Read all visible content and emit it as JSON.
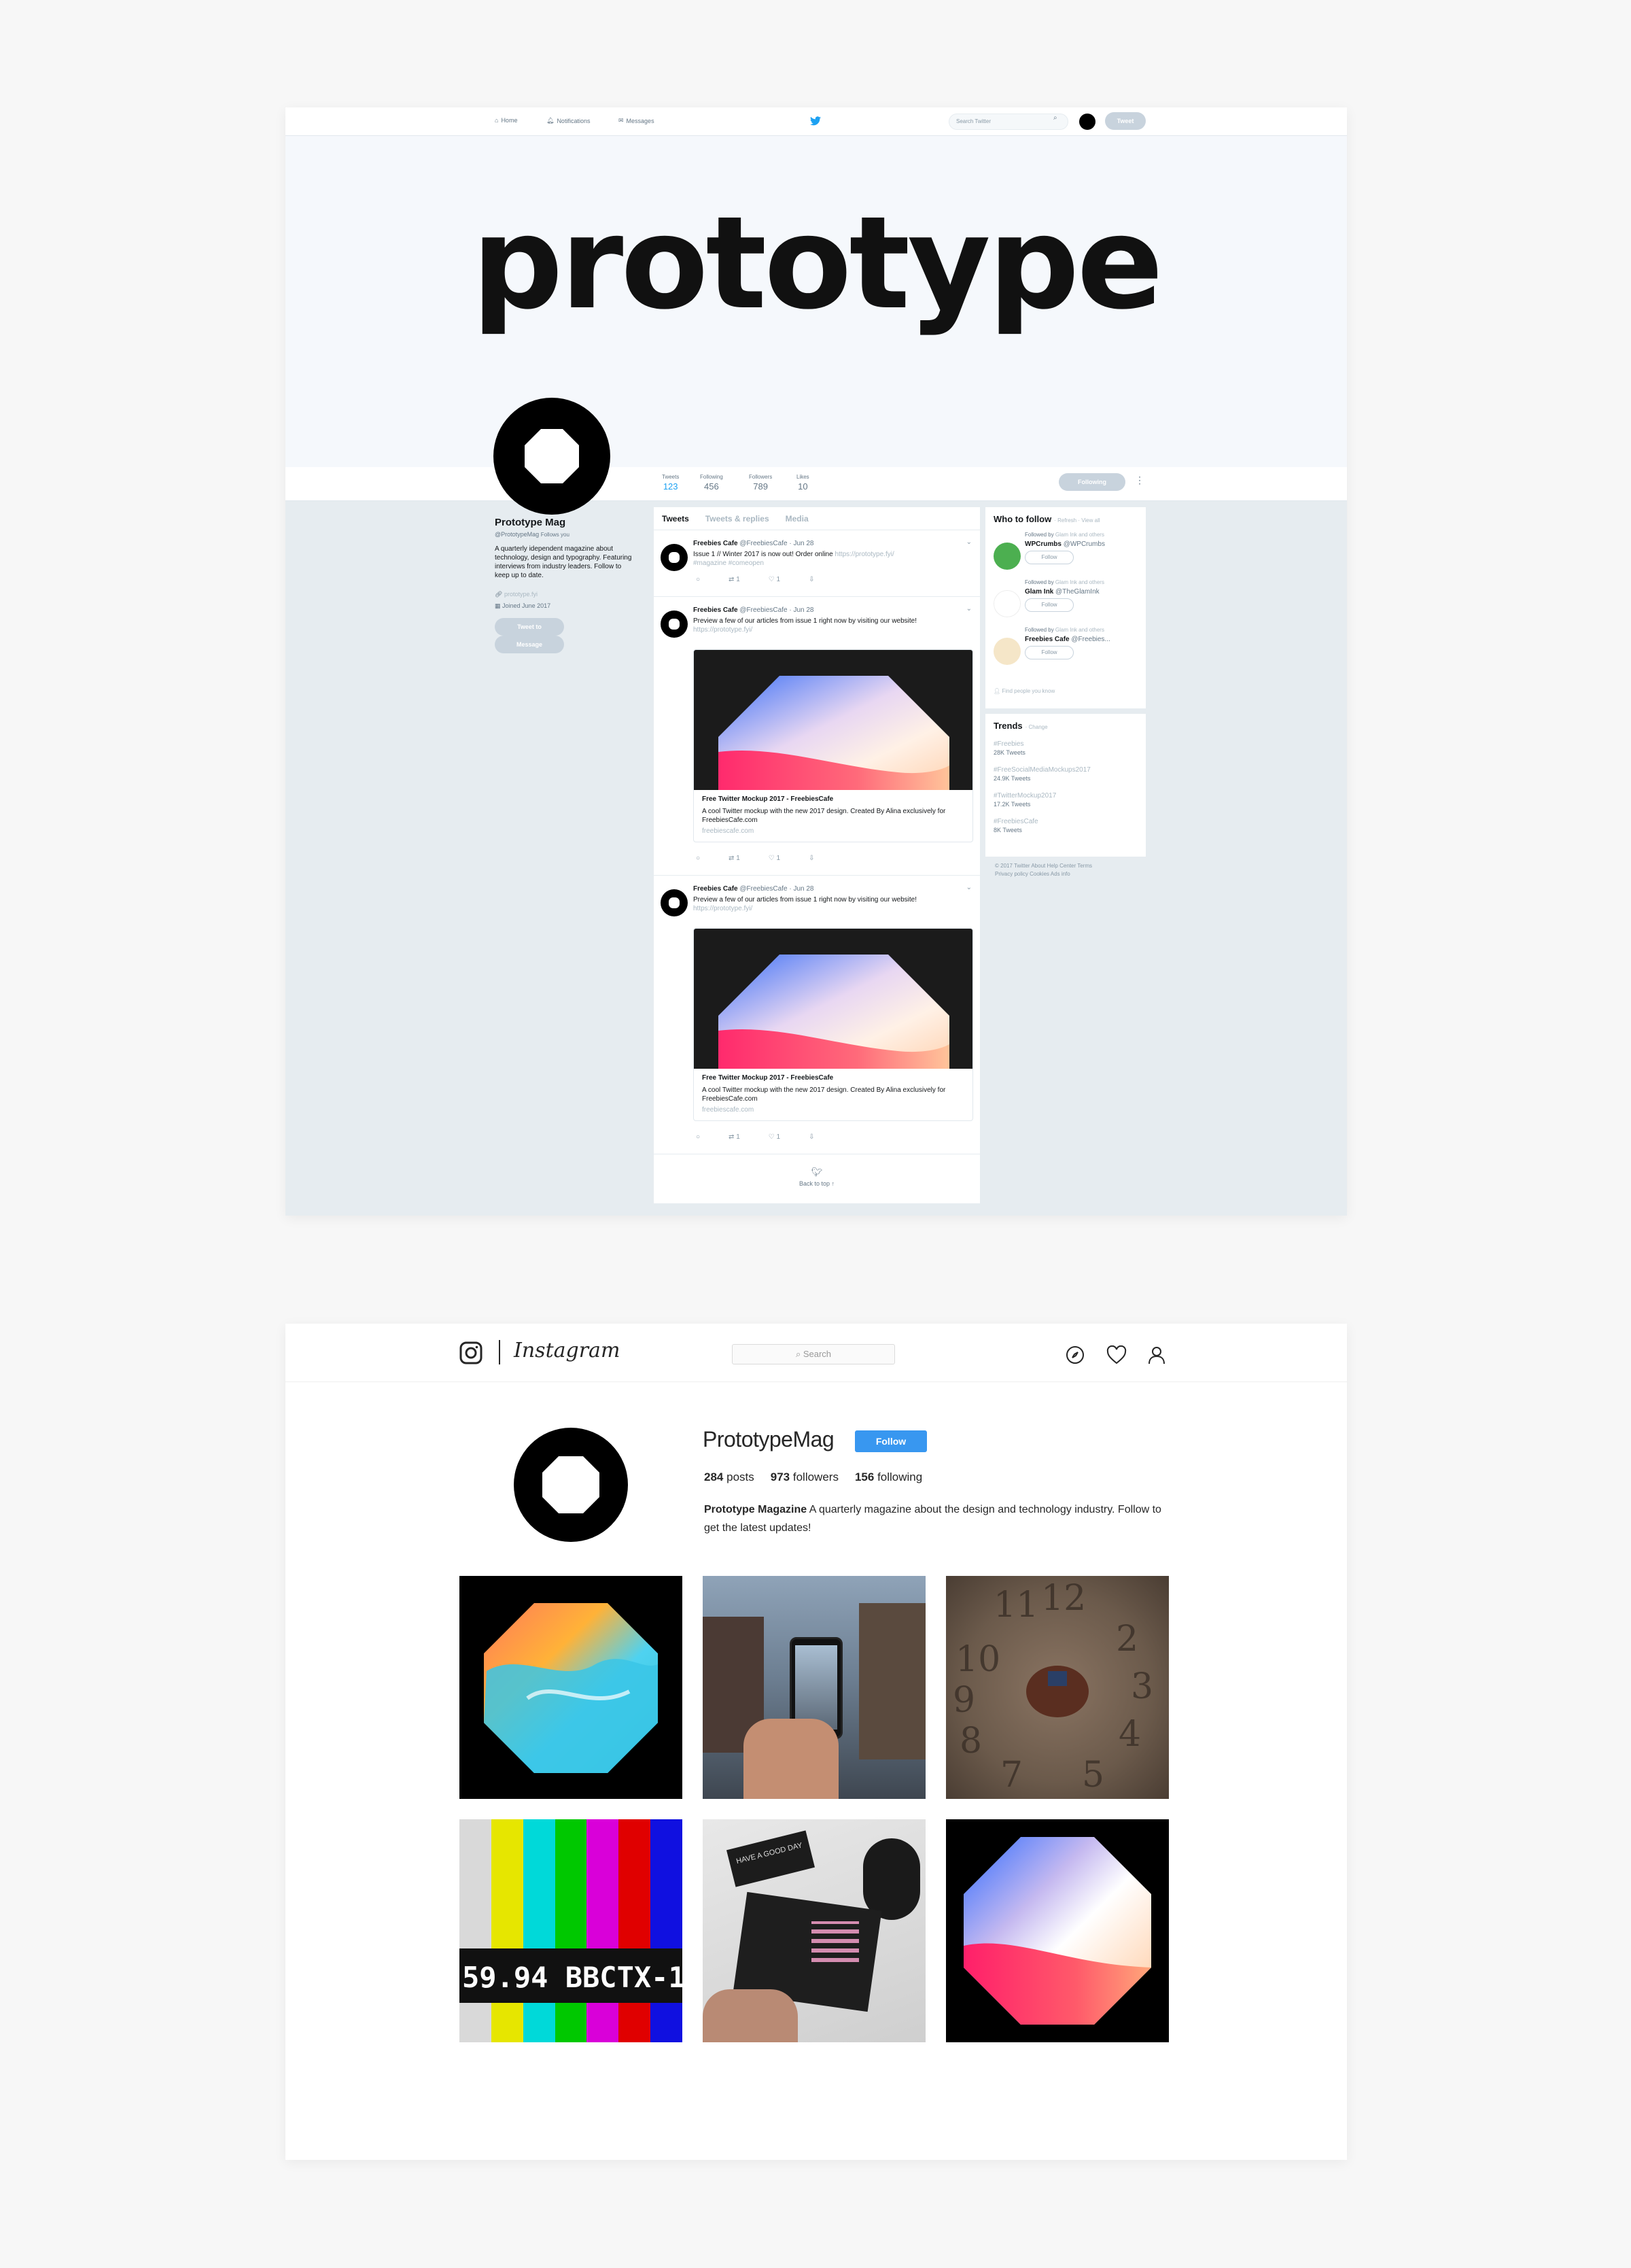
{
  "twitter": {
    "nav": {
      "home": "Home",
      "notifications": "Notifications",
      "messages": "Messages",
      "search_placeholder": "Search Twitter",
      "tweet_button": "Tweet"
    },
    "banner_text": "prototype",
    "stats": [
      {
        "label": "Tweets",
        "value": "123"
      },
      {
        "label": "Following",
        "value": "456"
      },
      {
        "label": "Followers",
        "value": "789"
      },
      {
        "label": "Likes",
        "value": "10"
      }
    ],
    "following_button": "Following",
    "profile": {
      "name": "Prototype Mag",
      "handle": "@PrototypeMag",
      "follows_you": "Follows you",
      "bio": "A quarterly idependent magazine about technology, design and typography. Featuring interviews from industry leaders. Follow to keep up to date.",
      "website": "prototype.fyi",
      "joined": "Joined June 2017",
      "tweet_to": "Tweet to",
      "message": "Message"
    },
    "tabs": {
      "tweets": "Tweets",
      "replies": "Tweets & replies",
      "media": "Media"
    },
    "tweets": [
      {
        "name": "Freebies Cafe",
        "meta": "@FreebiesCafe · Jun 28",
        "text": "Issue 1 // Winter 2017 is now out! Order online",
        "link": "https://prototype.fyi/",
        "tags": "#magazine #comeopen",
        "retweets": "1",
        "likes": "1"
      },
      {
        "name": "Freebies Cafe",
        "meta": "@FreebiesCafe · Jun 28",
        "text": "Preview a few of our articles from issue 1 right now by visiting our website!",
        "link": "https://prototype.fyi/",
        "card_title": "Free Twitter Mockup 2017 - FreebiesCafe",
        "card_desc": "A cool Twitter mockup with the new 2017 design. Created By Alina exclusively for FreebiesCafe.com",
        "card_url": "freebiescafe.com",
        "retweets": "1",
        "likes": "1"
      },
      {
        "name": "Freebies Cafe",
        "meta": "@FreebiesCafe · Jun 28",
        "text": "Preview a few of our articles from issue 1 right now by visiting our website!",
        "link": "https://prototype.fyi/",
        "card_title": "Free Twitter Mockup 2017 - FreebiesCafe",
        "card_desc": "A cool Twitter mockup with the new 2017 design. Created By Alina exclusively for FreebiesCafe.com",
        "card_url": "freebiescafe.com",
        "retweets": "1",
        "likes": "1"
      }
    ],
    "back_to_top": "Back to top ↑",
    "who_to_follow": {
      "title": "Who to follow",
      "refresh": "· Refresh · View all",
      "accounts": [
        {
          "followed_by": "Followed by",
          "by_names": "Glam Ink and others",
          "name": "WPCrumbs",
          "handle": "@WPCrumbs",
          "follow": "Follow",
          "color": "#4caf50"
        },
        {
          "followed_by": "Followed by",
          "by_names": "Glam Ink and others",
          "name": "Glam Ink",
          "handle": "@TheGlamInk",
          "follow": "Follow",
          "color": "#ffffff"
        },
        {
          "followed_by": "Followed by",
          "by_names": "Glam Ink and others",
          "name": "Freebies Cafe",
          "handle": "@Freebies...",
          "follow": "Follow",
          "color": "#f5e6c8"
        }
      ],
      "find_people": "Find people you know"
    },
    "trends": {
      "title": "Trends",
      "change": "· Change",
      "items": [
        {
          "tag": "#Freebies",
          "count": "28K Tweets"
        },
        {
          "tag": "#FreeSocialMediaMockups2017",
          "count": "24.9K Tweets"
        },
        {
          "tag": "#TwitterMockup2017",
          "count": "17.2K Tweets"
        },
        {
          "tag": "#FreebiesCafe",
          "count": "8K Tweets"
        }
      ]
    },
    "footer_line1": "© 2017 Twitter About Help Center Terms",
    "footer_line2": "Privacy policy Cookies Ads info"
  },
  "instagram": {
    "wordmark": "Instagram",
    "search_placeholder": "Search",
    "username": "PrototypeMag",
    "follow_button": "Follow",
    "posts": "284",
    "posts_label": "posts",
    "followers": "973",
    "followers_label": "followers",
    "following": "156",
    "following_label": "following",
    "bio_name": "Prototype Magazine",
    "bio_text": "A quarterly magazine about the design and technology industry. Follow to get the latest updates!",
    "grid_items": [
      "octagon-swirl",
      "phone-street",
      "clock-chair",
      "tv-test-pattern",
      "notebook-coffee",
      "octagon-gradient"
    ],
    "grid_text": {
      "tv_1": "59.94",
      "tv_2": "BBCTX-1",
      "cup_text": "HAVE A GOOD DAY"
    }
  }
}
